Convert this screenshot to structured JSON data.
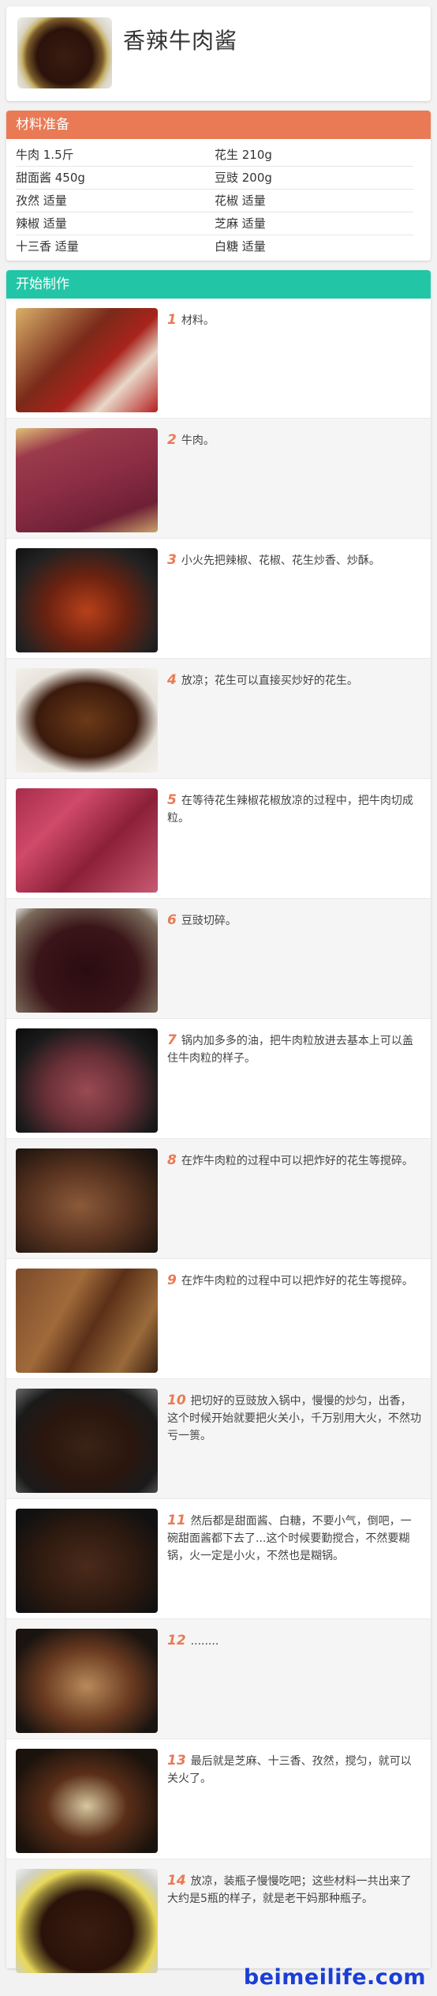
{
  "recipe": {
    "title": "香辣牛肉酱"
  },
  "ingredients": {
    "heading": "材料准备",
    "rows": [
      [
        "牛肉 1.5斤",
        "花生 210g"
      ],
      [
        "甜面酱 450g",
        "豆豉 200g"
      ],
      [
        "孜然 适量",
        "花椒 适量"
      ],
      [
        "辣椒 适量",
        "芝麻 适量"
      ],
      [
        "十三香 适量",
        "白糖 适量"
      ]
    ]
  },
  "steps": {
    "heading": "开始制作",
    "items": [
      {
        "num": "1",
        "text": "材料。"
      },
      {
        "num": "2",
        "text": "牛肉。"
      },
      {
        "num": "3",
        "text": "小火先把辣椒、花椒、花生炒香、炒酥。"
      },
      {
        "num": "4",
        "text": "放凉；花生可以直接买炒好的花生。"
      },
      {
        "num": "5",
        "text": "在等待花生辣椒花椒放凉的过程中，把牛肉切成粒。"
      },
      {
        "num": "6",
        "text": "豆豉切碎。"
      },
      {
        "num": "7",
        "text": "锅内加多多的油，把牛肉粒放进去基本上可以盖住牛肉粒的样子。"
      },
      {
        "num": "8",
        "text": "在炸牛肉粒的过程中可以把炸好的花生等搅碎。"
      },
      {
        "num": "9",
        "text": "在炸牛肉粒的过程中可以把炸好的花生等搅碎。"
      },
      {
        "num": "10",
        "text": "把切好的豆豉放入锅中，慢慢的炒匀，出香，这个时候开始就要把火关小，千万别用大火，不然功亏一篑。"
      },
      {
        "num": "11",
        "text": "然后都是甜面酱、白糖，不要小气，倒吧，一碗甜面酱都下去了...这个时候要勤搅合，不然要糊锅，火一定是小火，不然也是糊锅。"
      },
      {
        "num": "12",
        "text": "........"
      },
      {
        "num": "13",
        "text": "最后就是芝麻、十三香、孜然，搅匀，就可以关火了。"
      },
      {
        "num": "14",
        "text": "放凉，装瓶子慢慢吃吧；这些材料一共出来了大约是5瓶的样子，就是老干妈那种瓶子。"
      }
    ]
  },
  "footer": {
    "watermark": "beimeilife.com"
  },
  "colors": {
    "ingredients_bar": "#e97a55",
    "steps_bar": "#22c6a6",
    "step_number": "#e97a55",
    "watermark": "#1a3ed6"
  }
}
